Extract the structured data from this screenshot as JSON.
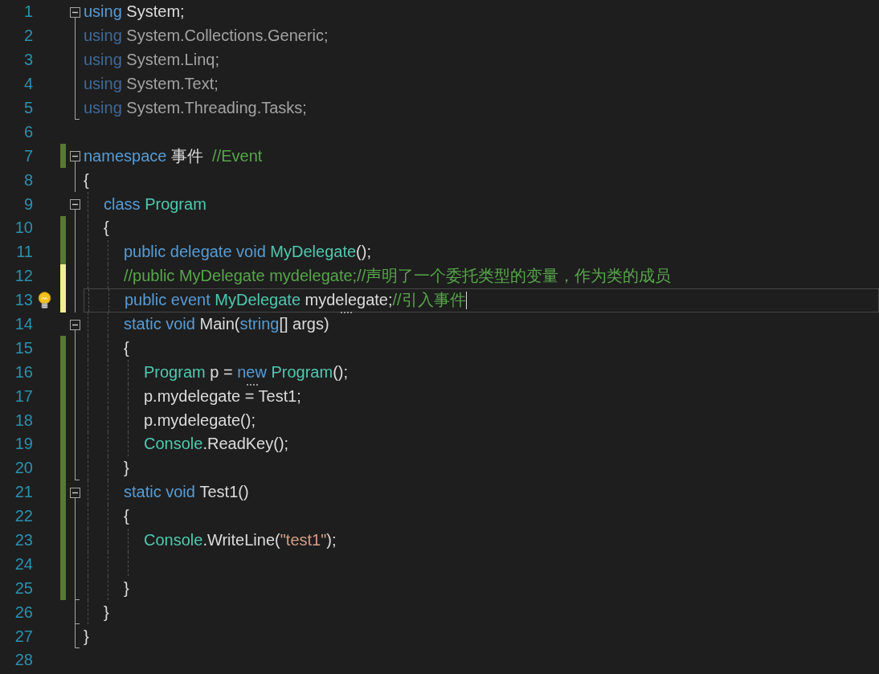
{
  "editor": {
    "lines": [
      {
        "number": "1",
        "fold_start": true,
        "tokens": [
          {
            "kind": "keyword",
            "text": "using"
          },
          {
            "kind": "plain",
            "text": " System;"
          }
        ]
      },
      {
        "number": "2",
        "faded": true,
        "tokens": [
          {
            "kind": "keyword",
            "text": "using"
          },
          {
            "kind": "plain",
            "text": " System.Collections.Generic;"
          }
        ]
      },
      {
        "number": "3",
        "faded": true,
        "tokens": [
          {
            "kind": "keyword",
            "text": "using"
          },
          {
            "kind": "plain",
            "text": " System.Linq;"
          }
        ]
      },
      {
        "number": "4",
        "faded": true,
        "tokens": [
          {
            "kind": "keyword",
            "text": "using"
          },
          {
            "kind": "plain",
            "text": " System.Text;"
          }
        ]
      },
      {
        "number": "5",
        "fold_end": true,
        "faded": true,
        "tokens": [
          {
            "kind": "keyword",
            "text": "using"
          },
          {
            "kind": "plain",
            "text": " System.Threading.Tasks;"
          }
        ]
      },
      {
        "number": "6"
      },
      {
        "number": "7",
        "saved": true,
        "fold_start": true,
        "tokens": [
          {
            "kind": "keyword",
            "text": "namespace"
          },
          {
            "kind": "plain",
            "text": " 事件  "
          },
          {
            "kind": "comment",
            "text": "//Event"
          }
        ]
      },
      {
        "number": "8",
        "tokens": [
          {
            "kind": "plain",
            "text": "{"
          }
        ],
        "children": [
          {
            "number": "9",
            "fold_start": true,
            "tokens": [
              {
                "kind": "keyword",
                "text": "class "
              },
              {
                "kind": "type",
                "text": "Program"
              }
            ]
          },
          {
            "number": "10",
            "saved": true,
            "tokens": [
              {
                "kind": "plain",
                "text": "{"
              }
            ],
            "children": [
              {
                "number": "11",
                "saved": true,
                "tokens": [
                  {
                    "kind": "keyword",
                    "text": "public delegate void "
                  },
                  {
                    "kind": "type",
                    "text": "MyDelegate"
                  },
                  {
                    "kind": "plain",
                    "text": "();"
                  }
                ]
              },
              {
                "number": "12",
                "saved": false,
                "tokens": [
                  {
                    "kind": "comment",
                    "text": "//public MyDelegate mydelegate;//声明了一个委托类型的变量，作为类的成员"
                  }
                ]
              },
              {
                "number": "13",
                "saved": false,
                "lightbulb": true,
                "current": true,
                "tokens": [
                  {
                    "kind": "keyword",
                    "text": "public event "
                  },
                  {
                    "kind": "type",
                    "text": "MyDelegate "
                  },
                  {
                    "kind": "plain",
                    "text": "mydelegate",
                    "hint": true
                  },
                  {
                    "kind": "plain",
                    "text": ";"
                  },
                  {
                    "kind": "comment",
                    "text": "//引入事件"
                  }
                ]
              },
              {
                "number": "14",
                "fold_start": true,
                "tokens": [
                  {
                    "kind": "keyword",
                    "text": "static void "
                  },
                  {
                    "kind": "plain",
                    "text": "Main("
                  },
                  {
                    "kind": "keyword",
                    "text": "string"
                  },
                  {
                    "kind": "plain",
                    "text": "[] args)"
                  }
                ]
              },
              {
                "number": "15",
                "saved": true,
                "tokens": [
                  {
                    "kind": "plain",
                    "text": "{"
                  }
                ],
                "children": [
                  {
                    "number": "16",
                    "saved": true,
                    "tokens": [
                      {
                        "kind": "type",
                        "text": "Program"
                      },
                      {
                        "kind": "plain",
                        "text": " p = "
                      },
                      {
                        "kind": "keyword",
                        "text": "new",
                        "hint": true
                      },
                      {
                        "kind": "type",
                        "text": " Program"
                      },
                      {
                        "kind": "plain",
                        "text": "();"
                      }
                    ]
                  },
                  {
                    "number": "17",
                    "saved": true,
                    "tokens": [
                      {
                        "kind": "plain",
                        "text": "p.mydelegate = Test1;"
                      }
                    ]
                  },
                  {
                    "number": "18",
                    "saved": true,
                    "tokens": [
                      {
                        "kind": "plain",
                        "text": "p.mydelegate();"
                      }
                    ]
                  },
                  {
                    "number": "19",
                    "saved": true,
                    "tokens": [
                      {
                        "kind": "type",
                        "text": "Console"
                      },
                      {
                        "kind": "plain",
                        "text": ".ReadKey();"
                      }
                    ]
                  }
                ]
              },
              {
                "number": "20",
                "saved": true,
                "fold_end": true,
                "tokens": [
                  {
                    "kind": "plain",
                    "text": "}"
                  }
                ]
              },
              {
                "number": "21",
                "saved": true,
                "fold_start": true,
                "tokens": [
                  {
                    "kind": "keyword",
                    "text": "static void "
                  },
                  {
                    "kind": "plain",
                    "text": "Test1()"
                  }
                ]
              },
              {
                "number": "22",
                "saved": true,
                "tokens": [
                  {
                    "kind": "plain",
                    "text": "{"
                  }
                ],
                "children": [
                  {
                    "number": "23",
                    "saved": true,
                    "tokens": [
                      {
                        "kind": "type",
                        "text": "Console"
                      },
                      {
                        "kind": "plain",
                        "text": ".WriteLine("
                      },
                      {
                        "kind": "string",
                        "text": "\"test1\""
                      },
                      {
                        "kind": "plain",
                        "text": ");"
                      }
                    ]
                  },
                  {
                    "number": "24",
                    "saved": true
                  }
                ]
              },
              {
                "number": "25",
                "saved": true,
                "fold_end": true,
                "tokens": [
                  {
                    "kind": "plain",
                    "text": "}"
                  }
                ]
              }
            ]
          },
          {
            "number": "26",
            "fold_end": true,
            "tokens": [
              {
                "kind": "plain",
                "text": "}"
              }
            ]
          }
        ]
      },
      {
        "number": "27",
        "fold_end": true,
        "tokens": [
          {
            "kind": "plain",
            "text": "}"
          }
        ]
      },
      {
        "number": "28"
      }
    ]
  }
}
